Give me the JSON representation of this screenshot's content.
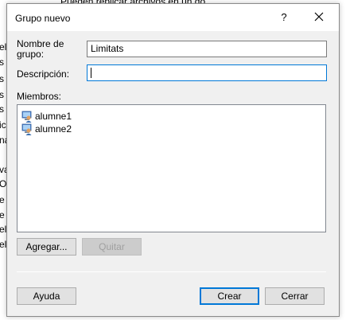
{
  "background": {
    "window_fragment_text": "Pueden replicar archivos en un do...",
    "left_fragments": [
      "el",
      "s c",
      "s c",
      "s c",
      "s c",
      "ic",
      "na",
      "va",
      "O",
      "e a",
      "e e",
      "el",
      "el"
    ]
  },
  "dialog": {
    "title": "Grupo nuevo",
    "help_glyph": "?",
    "fields": {
      "group_name_label_line1": "Nombre de",
      "group_name_label_line2": "grupo:",
      "group_name_value": "Limitats",
      "description_label": "Descripción:",
      "description_value": ""
    },
    "members_label": "Miembros:",
    "members": [
      {
        "name": "alumne1"
      },
      {
        "name": "alumne2"
      }
    ],
    "buttons": {
      "add": "Agregar...",
      "remove": "Quitar",
      "help": "Ayuda",
      "create": "Crear",
      "close": "Cerrar"
    }
  },
  "colors": {
    "dialog_bg": "#f0f0f0",
    "focus_border": "#0078d7"
  }
}
